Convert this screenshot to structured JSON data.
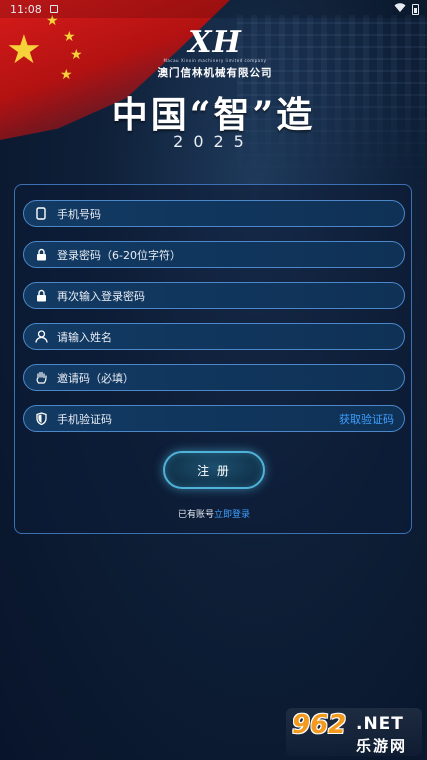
{
  "status_bar": {
    "time": "11:08"
  },
  "header": {
    "logo_mark": "XH",
    "logo_tagline": "Macau Xinxin machinery limited company",
    "company_name": "澳门信林机械有限公司",
    "slogan": "中国“智”造",
    "year": "2025"
  },
  "form": {
    "fields": [
      {
        "placeholder": "手机号码",
        "icon": "phone-icon"
      },
      {
        "placeholder": "登录密码（6-20位字符）",
        "icon": "lock-icon"
      },
      {
        "placeholder": "再次输入登录密码",
        "icon": "lock-icon"
      },
      {
        "placeholder": "请输入姓名",
        "icon": "user-icon"
      },
      {
        "placeholder": "邀请码（必填）",
        "icon": "hand-icon"
      },
      {
        "placeholder": "手机验证码",
        "icon": "shield-icon"
      }
    ],
    "get_code_label": "获取验证码",
    "register_label": "注 册",
    "have_account_text": "已有账号",
    "login_link": "立即登录"
  },
  "watermark": {
    "number": "962",
    "domain": ".NET",
    "name": "乐游网"
  },
  "colors": {
    "accent": "#3fa0ff",
    "border": "#4c87c9",
    "flag_red": "#d81b1b",
    "star_yellow": "#f6d23a"
  }
}
